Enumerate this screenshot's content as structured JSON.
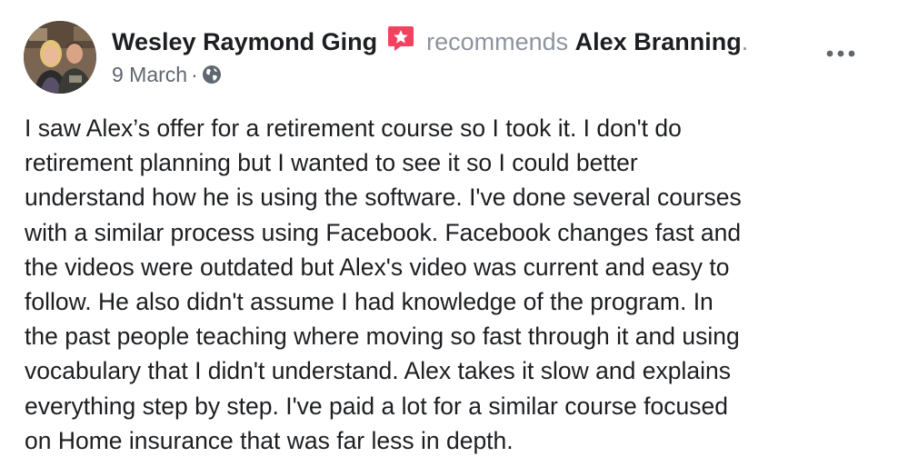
{
  "post": {
    "author": "Wesley Raymond Ging",
    "action": "recommends",
    "recommended": "Alex Branning",
    "period": ".",
    "date": "9 March",
    "separator": "·",
    "privacy_icon": "globe-icon",
    "recommend_icon": "recommendation-star-icon",
    "more_icon": "more-options-icon",
    "body_lines": [
      "I saw Alex’s offer for a retirement course so I took it.  I don't do",
      "retirement planning but I wanted to see it so I could better",
      "understand how he is using the software.  I've done several courses",
      "with a similar process using Facebook.  Facebook changes fast and",
      "the videos were outdated but Alex's video was current and easy to",
      "follow.  He also didn't assume I had knowledge of the program.  In",
      "the past people teaching where moving so fast through it and using",
      "vocabulary that I didn't understand.  Alex takes it slow and explains",
      "everything step by step. I've paid a lot for a similar course focused",
      "on Home insurance that was far less in depth."
    ]
  },
  "colors": {
    "recommend_accent": "#f3425f",
    "secondary_text": "#606770",
    "muted_text": "#8d949e",
    "primary_text": "#1c1e21"
  }
}
